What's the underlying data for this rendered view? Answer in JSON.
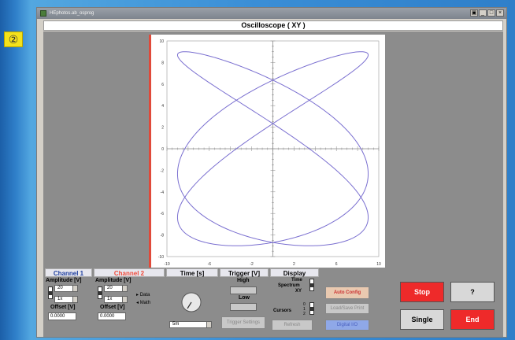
{
  "badge": "②",
  "window": {
    "title": "HEphotos.ab_osprog",
    "btn_min": "_",
    "btn_max": "□",
    "btn_close": "×",
    "btn_extra": "▣"
  },
  "scope_title": "Oscilloscope ( XY )",
  "plot": {
    "x_ticks": [
      "-10",
      "-6",
      "-2",
      "2",
      "6",
      "10"
    ],
    "y_ticks": [
      "10",
      "8",
      "6",
      "4",
      "2",
      "0",
      "-2",
      "-4",
      "-6",
      "-8",
      "-10"
    ],
    "xlim": [
      -10,
      10
    ],
    "ylim": [
      -10,
      10
    ],
    "grid": false,
    "curve": {
      "type": "lissajous",
      "x_amplitude": 9,
      "y_amplitude": 9,
      "x_frequency": 3,
      "y_frequency": 2,
      "color": "#7a6fd0"
    }
  },
  "channel1": {
    "header": "Channel 1",
    "amplitude_label": "Amplitude [V]",
    "amplitude_value": "20",
    "secondary_value": "1x",
    "offset_label": "Offset [V]",
    "offset_value": "0.0000"
  },
  "channel2": {
    "header": "Channel 2",
    "amplitude_label": "Amplitude [V]",
    "amplitude_value": "20",
    "secondary_value": "1x",
    "offset_label": "Offset [V]",
    "offset_value": "0.0000",
    "data_label": "Data",
    "math_label": "Math"
  },
  "time": {
    "header": "Time [s]",
    "value": "5m"
  },
  "trigger": {
    "header": "Trigger [V]",
    "high_label": "High",
    "low_label": "Low",
    "settings_button": "Trigger Settings"
  },
  "display": {
    "header": "Display",
    "time_label": "Time",
    "spectrum_label": "Spectrum",
    "xy_label": "XY",
    "cursors_label": "Cursors",
    "cursor_values": [
      "0",
      "1",
      "2"
    ],
    "refresh_button": "Refresh"
  },
  "actions": {
    "auto_config": "Auto Config",
    "load_save_print": "Load/Save Print",
    "digital_io": "Digital I/O"
  },
  "big_buttons": {
    "stop": "Stop",
    "help": "?",
    "single": "Single",
    "end": "End"
  },
  "colors": {
    "accent_red": "#ee2a2a",
    "channel1": "#1f3f9f",
    "channel2": "#f04a3a"
  }
}
